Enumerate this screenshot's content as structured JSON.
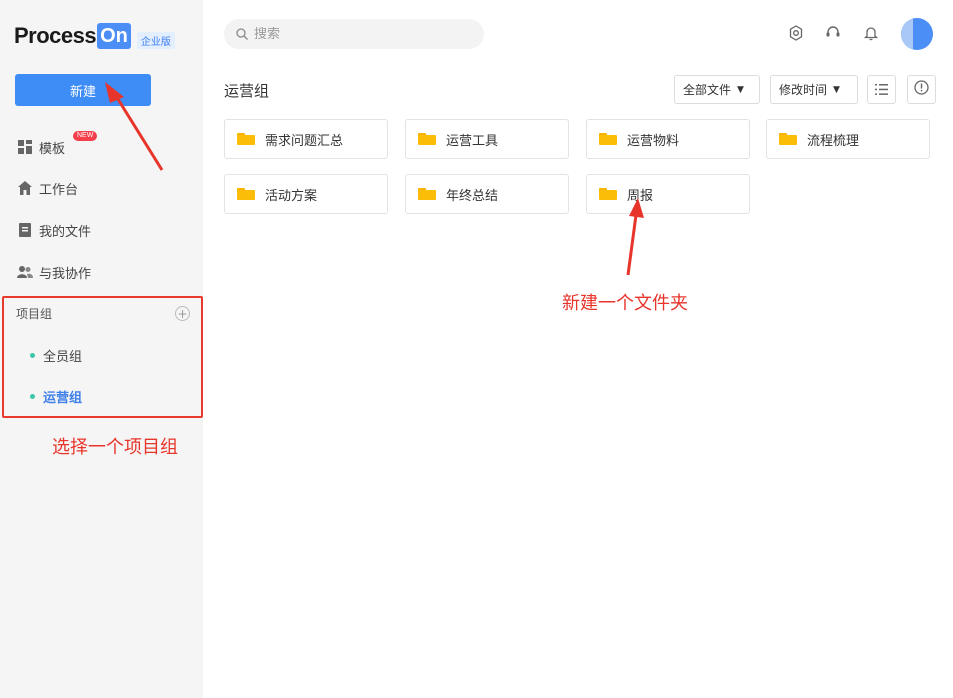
{
  "logo": {
    "word": "Process",
    "on": "On",
    "edition": "企业版"
  },
  "sidebar": {
    "new_button": "新建",
    "new_badge": "NEW",
    "items": [
      {
        "label": "模板",
        "icon": "template-icon"
      },
      {
        "label": "工作台",
        "icon": "home-icon"
      },
      {
        "label": "我的文件",
        "icon": "file-icon"
      },
      {
        "label": "与我协作",
        "icon": "collaborators-icon"
      }
    ],
    "group_title": "项目组",
    "groups": [
      {
        "label": "全员组",
        "active": false
      },
      {
        "label": "运营组",
        "active": true
      }
    ]
  },
  "search": {
    "placeholder": "搜索"
  },
  "header_icons": [
    "settings-icon",
    "support-icon",
    "bell-icon"
  ],
  "content": {
    "title": "运营组",
    "filter_dropdown": "全部文件",
    "sort_dropdown": "修改时间",
    "folders": [
      "需求问题汇总",
      "运营工具",
      "运营物料",
      "流程梳理",
      "活动方案",
      "年终总结",
      "周报"
    ]
  },
  "annotations": {
    "select_group": "选择一个项目组",
    "new_folder": "新建一个文件夹"
  },
  "colors": {
    "accent": "#3e8cf6",
    "annotation": "#e8352b",
    "folder": "#fbbd08",
    "group_dot": "#3cc6a8"
  }
}
